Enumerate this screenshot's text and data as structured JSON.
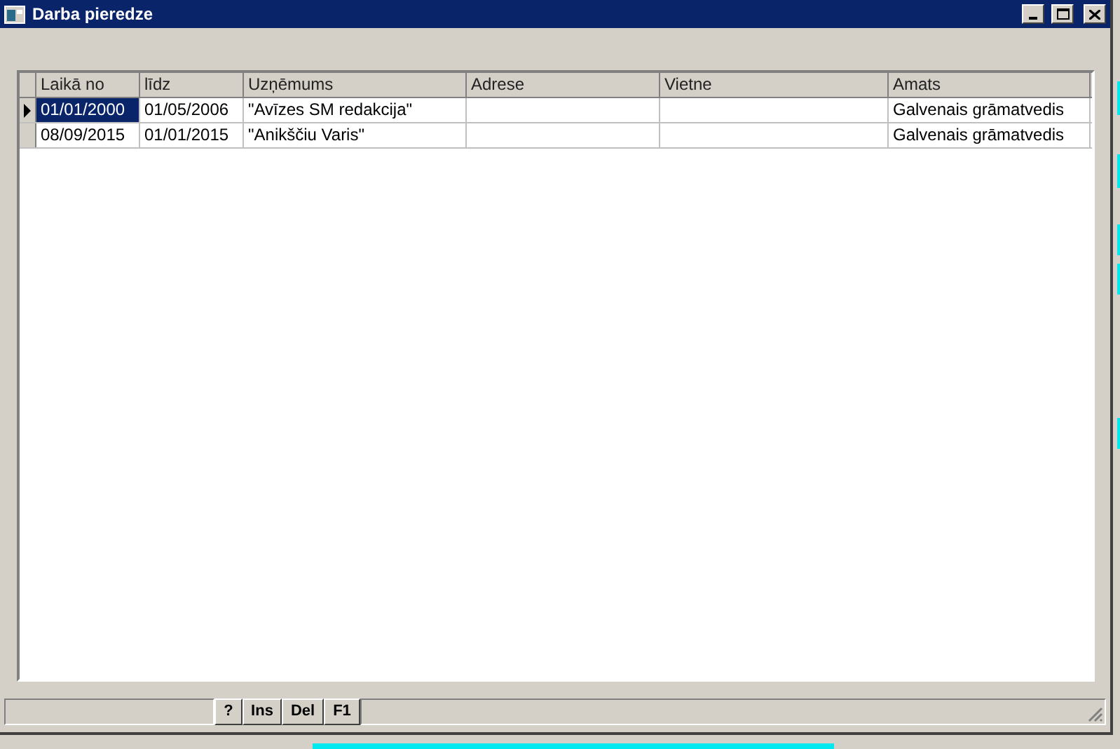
{
  "window": {
    "title": "Darba pieredze"
  },
  "table": {
    "columns": [
      "Laikā no",
      "līdz",
      "Uzņēmums",
      "Adrese",
      "Vietne",
      "Amats"
    ],
    "rows": [
      {
        "selected": true,
        "cells": [
          "01/01/2000",
          "01/05/2006",
          "\"Avīzes SM redakcija\"",
          "",
          "",
          "Galvenais grāmatvedis"
        ]
      },
      {
        "selected": false,
        "cells": [
          "08/09/2015",
          "01/01/2015",
          "\"Anikščiu Varis\"",
          "",
          "",
          "Galvenais grāmatvedis"
        ]
      }
    ]
  },
  "status_bar": {
    "buttons": [
      "?",
      "Ins",
      "Del",
      "F1"
    ]
  }
}
